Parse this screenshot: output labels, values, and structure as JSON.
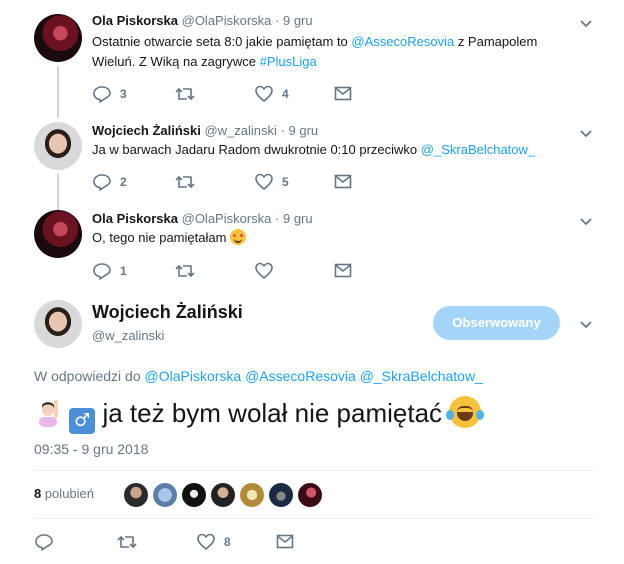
{
  "tweets": [
    {
      "name": "Ola Piskorska",
      "handle": "@OlaPiskorska",
      "date": "· 9 gru",
      "text_1": "Ostatnie otwarcie seta 8:0 jakie pamiętam to ",
      "mention_1": "@AssecoResovia",
      "text_2": " z Pamapolem Wieluń. Z Wiką na zagrywce ",
      "hashtag": "#PlusLiga",
      "reply_count": "3",
      "retweet_count": "",
      "like_count": "4"
    },
    {
      "name": "Wojciech Żaliński",
      "handle": "@w_zalinski",
      "date": "· 9 gru",
      "text_1": "Ja w barwach Jadaru Radom dwukrotnie 0:10 przeciwko ",
      "mention_1": "@_SkraBelchatow_",
      "reply_count": "2",
      "retweet_count": "",
      "like_count": "5"
    },
    {
      "name": "Ola Piskorska",
      "handle": "@OlaPiskorska",
      "date": "· 9 gru",
      "text_1": "O, tego nie pamiętałam ",
      "reply_count": "1",
      "retweet_count": "",
      "like_count": ""
    }
  ],
  "main": {
    "name": "Wojciech Żaliński",
    "handle": "@w_zalinski",
    "follow_label": "Obserwowany",
    "reply_to_prefix": "W odpowiedzi do ",
    "reply_to_1": "@OlaPiskorska",
    "reply_to_2": "@AssecoResovia",
    "reply_to_3": "@_SkraBelchatow_",
    "text": " ja też bym wolał nie pamiętać ",
    "male_sign": "♂",
    "timestamp": "09:35 - 9 gru 2018",
    "likes_number": "8",
    "likes_label": " polubień",
    "reply_count": "",
    "retweet_count": "",
    "like_count": "8"
  },
  "colors": {
    "link": "#1da1f2",
    "muted": "#657786",
    "follow_button": "#a4d4f7"
  },
  "icons": [
    "reply-icon",
    "retweet-icon",
    "like-icon",
    "message-icon",
    "chevron-down-icon"
  ]
}
